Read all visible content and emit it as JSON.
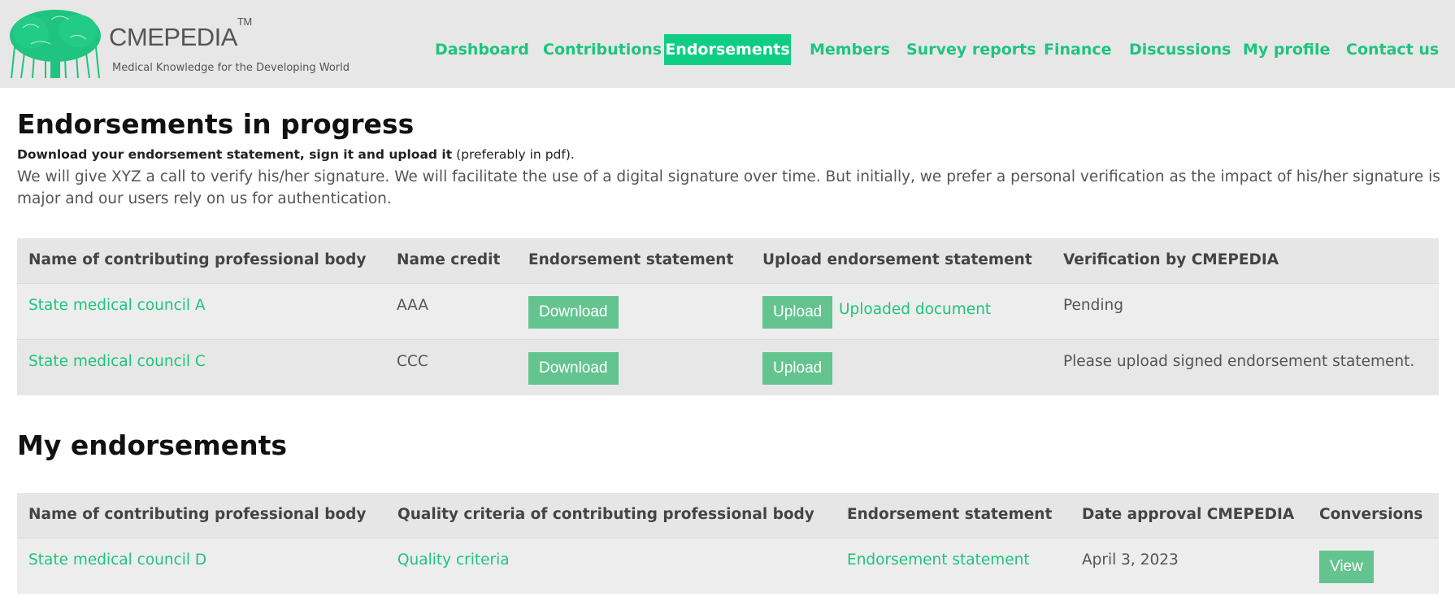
{
  "header": {
    "brand": "CMEPEDIA",
    "trademark": "TM",
    "tagline": "Medical Knowledge for the Developing World",
    "logo_icon": "tree-icon",
    "accent": "#0fcd84"
  },
  "nav": {
    "items": [
      {
        "label": "Dashboard"
      },
      {
        "label": "Contributions"
      },
      {
        "label": "Endorsements",
        "active": true
      },
      {
        "label": "Members"
      },
      {
        "label": "Survey reports"
      },
      {
        "label": "Finance"
      },
      {
        "label": "Discussions"
      },
      {
        "label": "My profile"
      },
      {
        "label": "Contact us"
      }
    ]
  },
  "in_progress": {
    "title": "Endorsements in progress",
    "instruction_strong": "Download your endorsement statement, sign it and upload it",
    "instruction_note": " (preferably in pdf).",
    "paragraph": "We will give XYZ a call to verify his/her signature. We will facilitate the use of a digital signature over time. But initially, we prefer a personal verification as the impact of his/her signature is major and our users rely on us for authentication.",
    "columns": [
      "Name of contributing professional body",
      "Name credit",
      "Endorsement statement",
      "Upload endorsement statement",
      "Verification by CMEPEDIA"
    ],
    "rows": [
      {
        "body": "State medical council A",
        "credit": "AAA",
        "download": "Download",
        "upload": "Upload",
        "uploaded": "Uploaded document",
        "verification": "Pending"
      },
      {
        "body": "State medical council C",
        "credit": "CCC",
        "download": "Download",
        "upload": "Upload",
        "uploaded": "",
        "verification": "Please upload signed endorsement statement."
      }
    ]
  },
  "mine": {
    "title": "My endorsements",
    "columns": [
      "Name of contributing professional body",
      "Quality criteria of contributing professional body",
      "Endorsement statement",
      "Date approval CMEPEDIA",
      "Conversions"
    ],
    "rows": [
      {
        "body": "State medical council D",
        "criteria": "Quality criteria",
        "statement": "Endorsement statement",
        "date": "April 3, 2023",
        "conversions": "View"
      }
    ]
  }
}
